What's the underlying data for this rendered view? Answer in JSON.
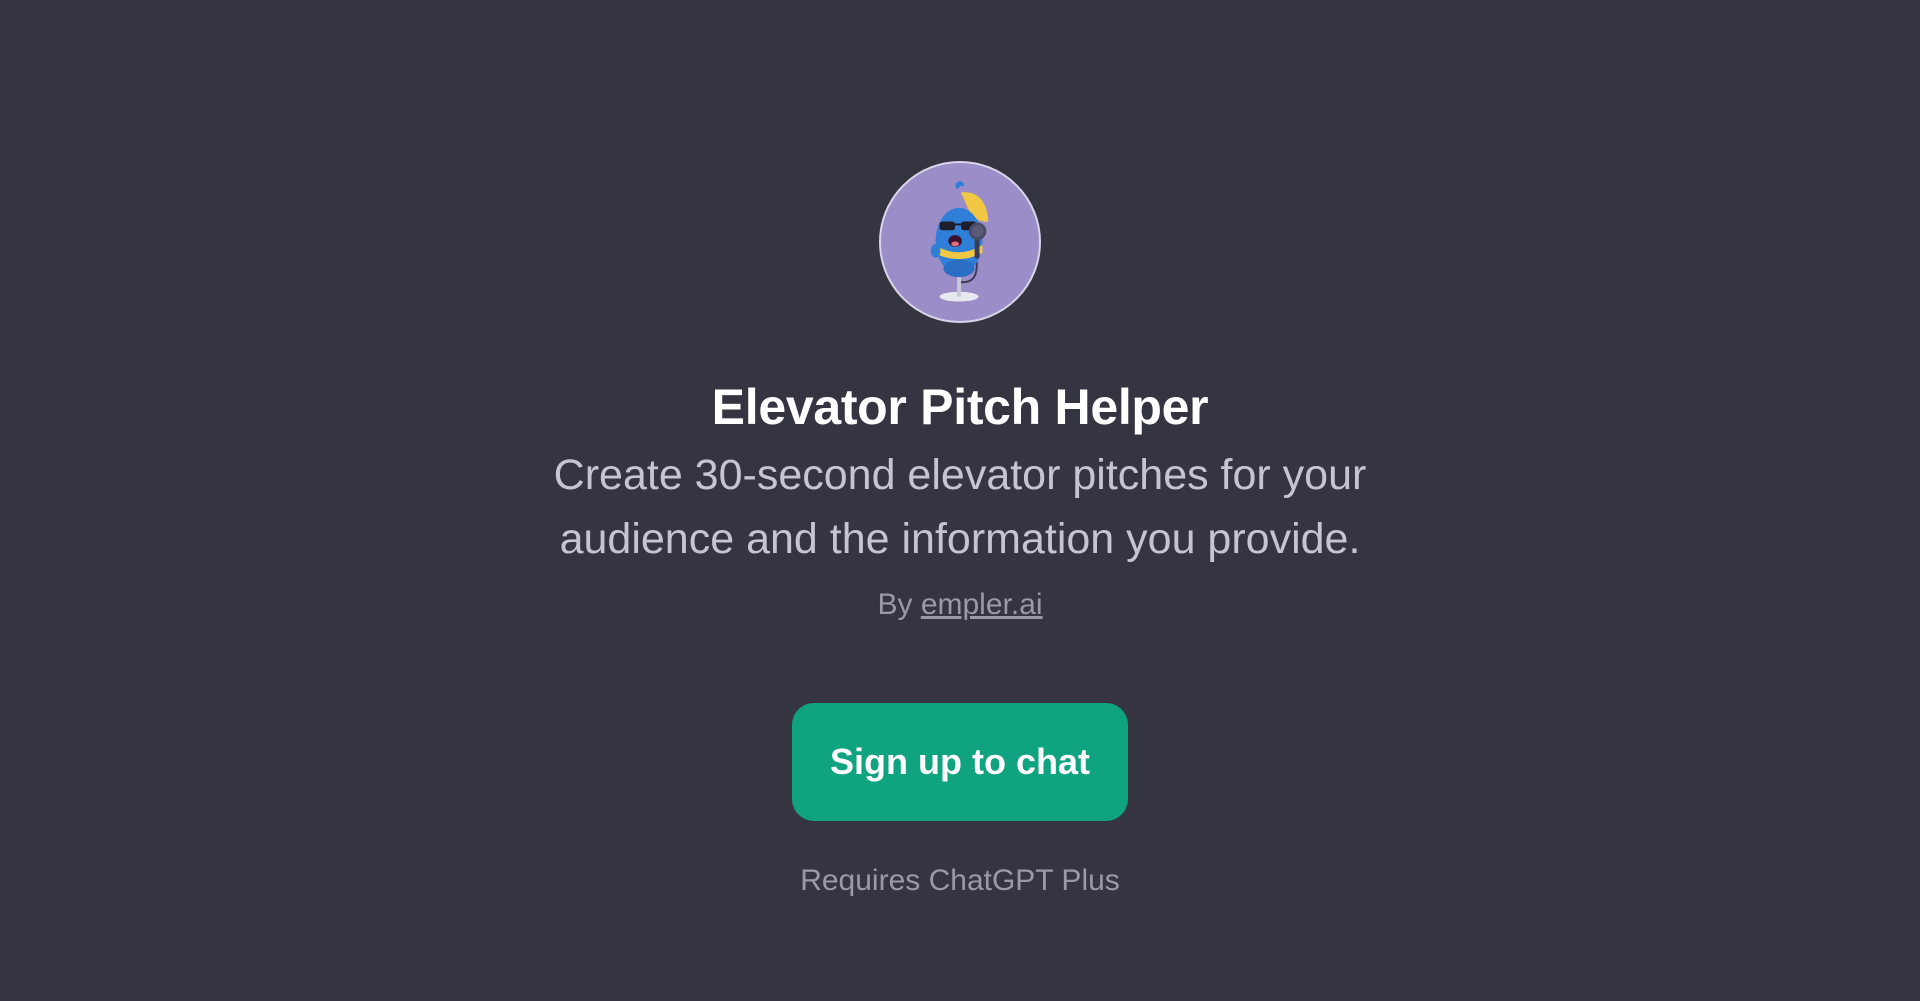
{
  "gpt": {
    "avatar_icon": "singing-mascot-icon",
    "title": "Elevator Pitch Helper",
    "description": "Create 30-second elevator pitches for your audience and the information you provide.",
    "author_prefix": "By",
    "author_link": "empler.ai"
  },
  "cta": {
    "label": "Sign up to chat"
  },
  "footer": {
    "note": "Requires ChatGPT Plus"
  },
  "colors": {
    "background": "#343541",
    "accent": "#10a37f",
    "avatar_bg": "#9b8dc8"
  }
}
